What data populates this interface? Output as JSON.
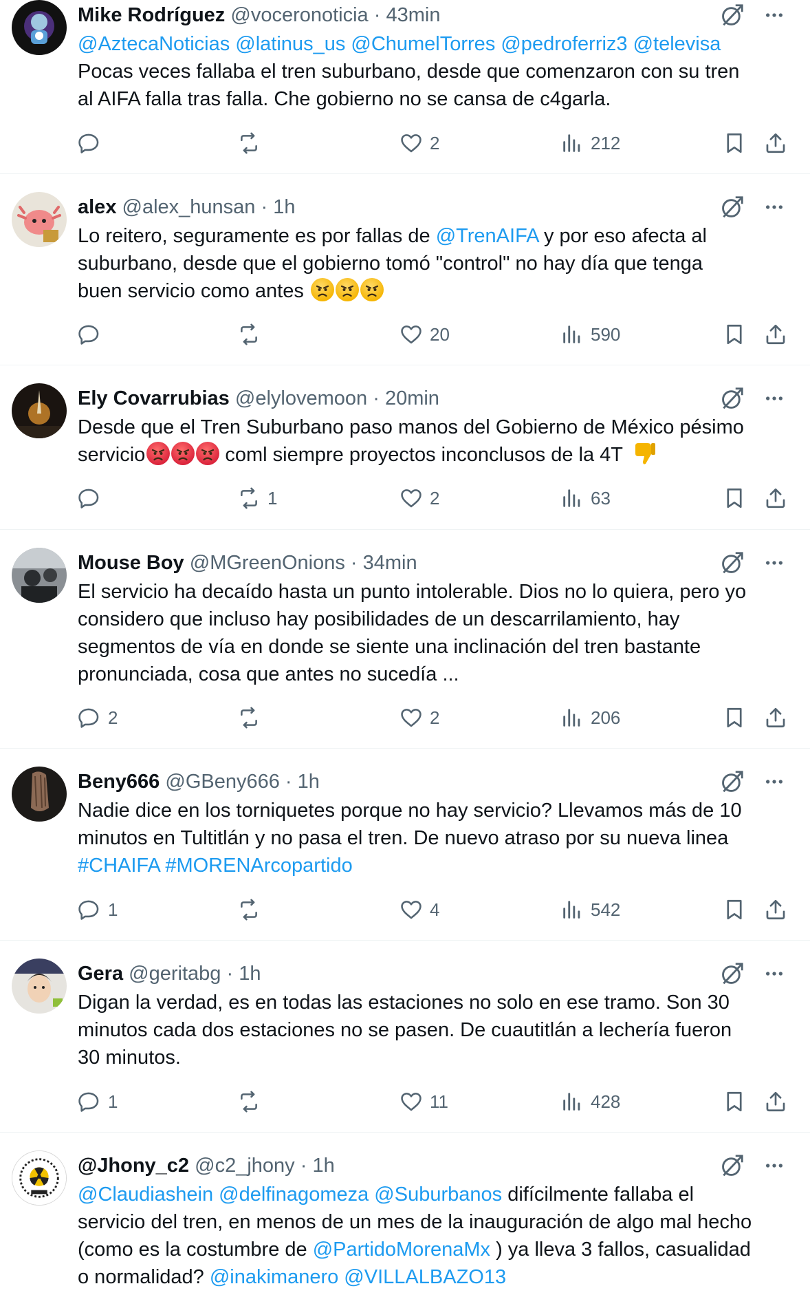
{
  "tweets": [
    {
      "name": "Mike Rodríguez",
      "handle": "@voceronoticia",
      "time": "43min",
      "lines": [
        "@AztecaNoticias @latinus_us @ChumelTorres @pedroferriz3 @televisa",
        "Pocas veces fallaba el tren suburbano, desde que comenzaron con su tren",
        "al AIFA falla tras falla. Che gobierno no se cansa de c4garla."
      ],
      "replies": "",
      "retweets": "",
      "likes": "2",
      "views": "212"
    },
    {
      "name": "alex",
      "handle": "@alex_hunsan",
      "time": "1h",
      "text_a": "Lo reitero, seguramente es por fallas de ",
      "mention": "@TrenAIFA",
      "text_b": " y por eso afecta al",
      "line2": "suburbano, desde que el gobierno tomó \"control\" no hay día que tenga",
      "line3": "buen servicio como antes ",
      "replies": "",
      "retweets": "",
      "likes": "20",
      "views": "590"
    },
    {
      "name": "Ely Covarrubias",
      "handle": "@elylovemoon",
      "time": "20min",
      "line1": "Desde que el Tren Suburbano paso manos del Gobierno de México pésimo",
      "line2a": "servicio",
      "line2b": " coml siempre proyectos  inconclusos de la 4T ",
      "replies": "",
      "retweets": "1",
      "likes": "2",
      "views": "63"
    },
    {
      "name": "Mouse Boy",
      "handle": "@MGreenOnions",
      "time": "34min",
      "lines": [
        "El servicio ha decaído hasta un punto intolerable. Dios no lo quiera, pero yo",
        "considero que incluso hay posibilidades de un descarrilamiento, hay",
        "segmentos de vía en donde se siente una inclinación del tren bastante",
        "pronunciada, cosa que antes no sucedía ..."
      ],
      "replies": "2",
      "retweets": "",
      "likes": "2",
      "views": "206"
    },
    {
      "name": "Beny666",
      "handle": "@GBeny666",
      "time": "1h",
      "lines": [
        "Nadie dice en los torniquetes porque no hay servicio? Llevamos más de 10",
        "minutos en Tultitlán y no pasa el tren. De nuevo atraso por su nueva linea"
      ],
      "tags": "#CHAIFA #MORENArcopartido",
      "replies": "1",
      "retweets": "",
      "likes": "4",
      "views": "542"
    },
    {
      "name": "Gera",
      "handle": "@geritabg",
      "time": "1h",
      "lines": [
        "Digan la verdad, es en todas las estaciones no solo en ese tramo.  Son 30",
        "minutos cada dos estaciones no se pasen.  De cuautitlán a lechería fueron",
        "30 minutos."
      ],
      "replies": "1",
      "retweets": "",
      "likes": "11",
      "views": "428"
    },
    {
      "name": "@Jhony_c2",
      "handle": "@c2_jhony",
      "time": "1h",
      "mentions1": "@Claudiashein @delfinagomeza @Suburbanos",
      "text1": " difícilmente fallaba el",
      "line2": "servicio del tren, en menos de un mes de la inauguración de algo mal hecho",
      "line3a": "(como es la costumbre de ",
      "line3m": "@PartidoMorenaMx",
      "line3b": " ) ya lleva 3 fallos, casualidad",
      "line4a": "o normalidad? ",
      "line4m": "@inakimanero @VILLALBAZO13"
    }
  ],
  "separator": "·",
  "icons": [
    "grok-icon",
    "more-icon",
    "reply-icon",
    "retweet-icon",
    "like-icon",
    "views-icon",
    "bookmark-icon",
    "share-icon"
  ],
  "colors": {
    "link": "#1d9bf0",
    "secondary": "#536471",
    "text": "#0f1419",
    "divider": "#eff3f4"
  }
}
